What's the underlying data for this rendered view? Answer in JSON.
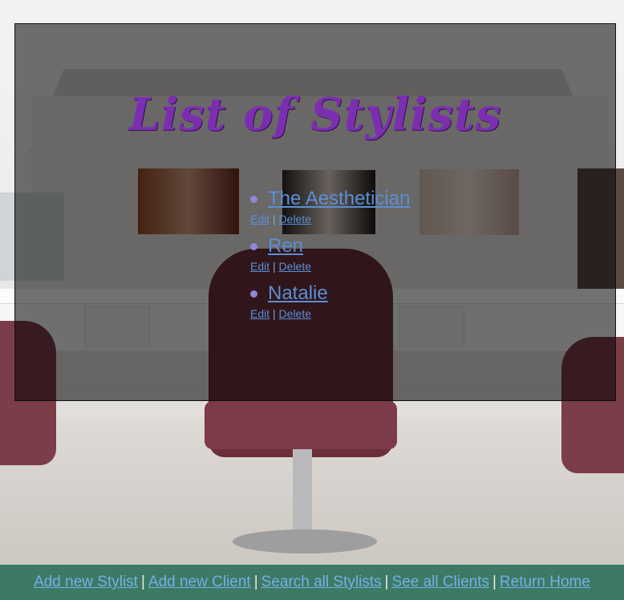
{
  "page": {
    "title": "List of Stylists"
  },
  "stylists": [
    {
      "name": "The Aesthetician",
      "edit_label": "Edit",
      "separator": "|",
      "delete_label": "Delete"
    },
    {
      "name": "Ren",
      "edit_label": "Edit",
      "separator": "|",
      "delete_label": "Delete"
    },
    {
      "name": "Natalie",
      "edit_label": "Edit",
      "separator": "|",
      "delete_label": "Delete"
    }
  ],
  "footer": {
    "separator": "|",
    "links": [
      "Add new Stylist",
      "Add new Client",
      "Search all Stylists",
      "See all Clients",
      "Return Home"
    ]
  },
  "colors": {
    "title": "#7b2fb0",
    "link": "#5b8fd6",
    "footer_bg": "#2a6e58",
    "bullet": "#8f86d6"
  }
}
